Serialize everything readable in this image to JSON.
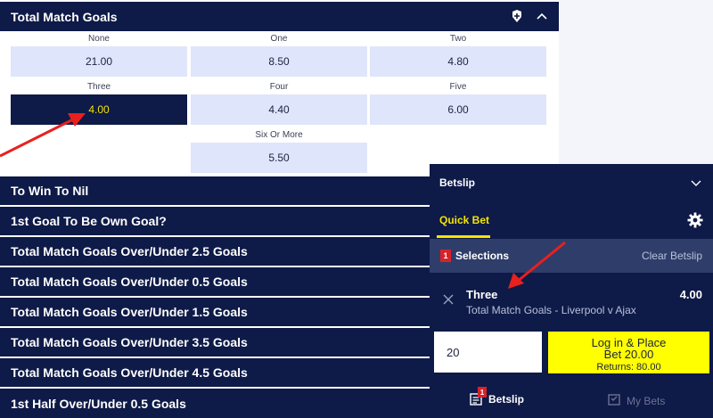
{
  "market": {
    "title": "Total Match Goals",
    "options": [
      {
        "label": "None",
        "odds": "21.00"
      },
      {
        "label": "One",
        "odds": "8.50"
      },
      {
        "label": "Two",
        "odds": "4.80"
      },
      {
        "label": "Three",
        "odds": "4.00",
        "selected": true
      },
      {
        "label": "Four",
        "odds": "4.40"
      },
      {
        "label": "Five",
        "odds": "6.00"
      },
      {
        "label": "Six Or More",
        "odds": "5.50"
      }
    ]
  },
  "collapsed_markets": [
    "To Win To Nil",
    "1st Goal To Be Own Goal?",
    "Total Match Goals Over/Under 2.5 Goals",
    "Total Match Goals Over/Under 0.5 Goals",
    "Total Match Goals Over/Under 1.5 Goals",
    "Total Match Goals Over/Under 3.5 Goals",
    "Total Match Goals Over/Under 4.5 Goals",
    "1st Half Over/Under 0.5 Goals"
  ],
  "betslip": {
    "title": "Betslip",
    "quick_bet_tab": "Quick Bet",
    "selections_count": "1",
    "selections_label": "Selections",
    "clear_label": "Clear Betslip",
    "item": {
      "name": "Three",
      "market": "Total Match Goals - Liverpool v Ajax",
      "odds": "4.00"
    },
    "stake": "20",
    "place_line1": "Log in & Place",
    "place_line2": "Bet 20.00",
    "returns": "Returns: 80.00",
    "bottom_betslip": "Betslip",
    "bottom_badge": "1",
    "bottom_mybets": "My Bets"
  },
  "colors": {
    "navy": "#0e1a47",
    "odds_bg": "#dfe5fa",
    "accent_yellow": "#f5e400",
    "place_yellow": "#ffff00",
    "annotation_red": "#e8201e"
  },
  "icons": {
    "header": [
      "stats-icon",
      "chevron-up-icon"
    ],
    "betslip": [
      "chevron-down-icon",
      "gear-icon",
      "close-icon",
      "betslip-icon",
      "my-bets-icon"
    ]
  }
}
